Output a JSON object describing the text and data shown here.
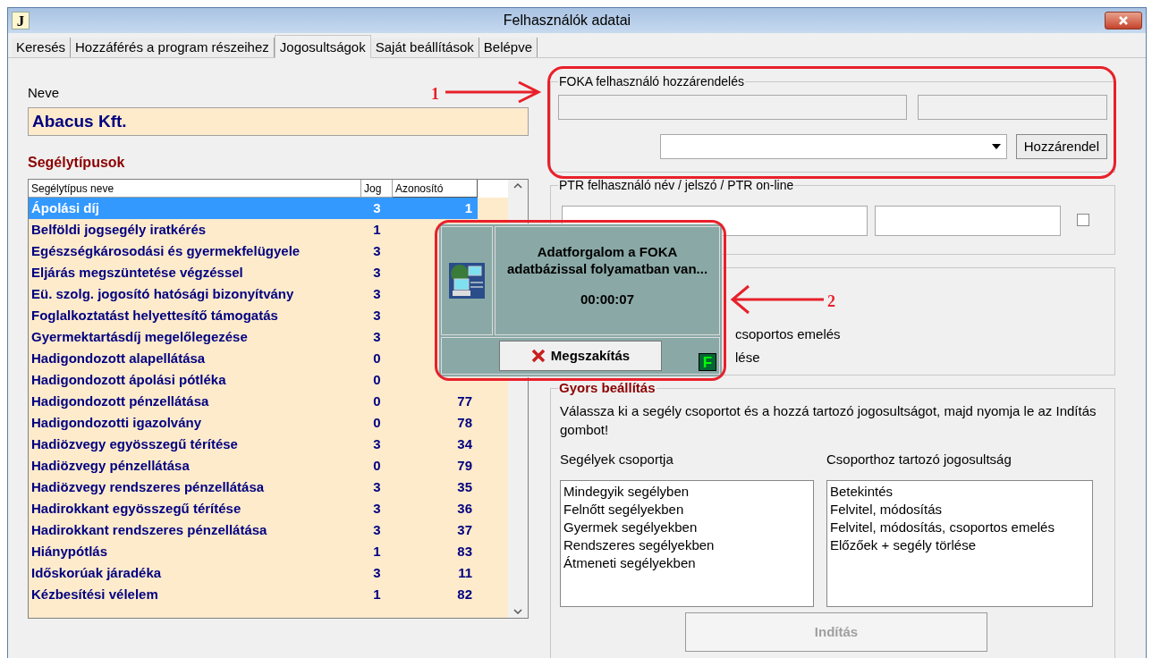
{
  "window": {
    "icon_letter": "J",
    "title": "Felhasználók adatai"
  },
  "tabs": [
    {
      "label": "Keresés",
      "selected": false
    },
    {
      "label": "Hozzáférés a program részeihez",
      "selected": false
    },
    {
      "label": "Jogosultságok",
      "selected": true
    },
    {
      "label": "Saját beállítások",
      "selected": false
    },
    {
      "label": "Belépve",
      "selected": false
    }
  ],
  "left": {
    "name_label": "Neve",
    "name_value": "Abacus Kft.",
    "list_title": "Segélytípusok",
    "table": {
      "columns": [
        "Segélytípus neve",
        "Jog",
        "Azonosító"
      ],
      "rows": [
        {
          "name": "Ápolási díj",
          "jog": "3",
          "id": "1",
          "selected": true
        },
        {
          "name": "Belföldi jogsegély iratkérés",
          "jog": "1",
          "selected": false
        },
        {
          "name": "Egészségkárosodási és gyermekfelügyele",
          "jog": "3",
          "selected": false
        },
        {
          "name": "Eljárás megszüntetése végzéssel",
          "jog": "3",
          "selected": false
        },
        {
          "name": "Eü. szolg. jogosító hatósági bizonyítvány",
          "jog": "3",
          "selected": false
        },
        {
          "name": "Foglalkoztatást helyettesítő támogatás",
          "jog": "3",
          "selected": false
        },
        {
          "name": "Gyermektartásdíj megelőlegezése",
          "jog": "3",
          "selected": false
        },
        {
          "name": "Hadigondozott alapellátása",
          "jog": "0",
          "selected": false
        },
        {
          "name": "Hadigondozott ápolási pótléka",
          "jog": "0",
          "selected": false
        },
        {
          "name": "Hadigondozott pénzellátása",
          "jog": "0",
          "id": "77",
          "selected": false
        },
        {
          "name": "Hadigondozotti igazolvány",
          "jog": "0",
          "id": "78",
          "selected": false
        },
        {
          "name": "Hadiözvegy egyösszegű térítése",
          "jog": "3",
          "id": "34",
          "selected": false
        },
        {
          "name": "Hadiözvegy pénzellátása",
          "jog": "0",
          "id": "79",
          "selected": false
        },
        {
          "name": "Hadiözvegy rendszeres pénzellátása",
          "jog": "3",
          "id": "35",
          "selected": false
        },
        {
          "name": "Hadirokkant egyösszegű térítése",
          "jog": "3",
          "id": "36",
          "selected": false
        },
        {
          "name": "Hadirokkant rendszeres pénzellátása",
          "jog": "3",
          "id": "37",
          "selected": false
        },
        {
          "name": "Hiánypótlás",
          "jog": "1",
          "id": "83",
          "selected": false
        },
        {
          "name": "Időskorúak járadéka",
          "jog": "3",
          "id": "11",
          "selected": false
        },
        {
          "name": "Kézbesítési vélelem",
          "jog": "1",
          "id": "82",
          "selected": false
        }
      ]
    }
  },
  "foka_group": {
    "legend": "FOKA felhasználó hozzárendelés",
    "button": "Hozzárendel"
  },
  "ptr_group": {
    "legend": "PTR felhasználó név / jelszó / PTR on-line",
    "checkbox": {
      "checked": false
    }
  },
  "rights_group": {
    "lines": [
      "csoportos emelés",
      "lése"
    ]
  },
  "quick_setup": {
    "legend": "Gyors beállítás",
    "instruction": "Válassza ki a segély csoportot és a  hozzá tartozó jogosultságot, majd nyomja le az Indítás gombot!",
    "groups_label": "Segélyek csoportja",
    "groups": [
      "Mindegyik segélyben",
      "Felnőtt segélyekben",
      "Gyermek segélyekben",
      "Rendszeres segélyekben",
      "Átmeneti segélyekben"
    ],
    "rights_label": "Csoporthoz tartozó jogosultság",
    "rights": [
      "Betekintés",
      "Felvitel, módosítás",
      "Felvitel, módosítás, csoportos emelés",
      "Előzőek + segély törlése"
    ],
    "start_button": {
      "label": "Indítás",
      "disabled": true
    }
  },
  "progress_dialog": {
    "message": "Adatforgalom a FOKA adatbázissal folyamatban van...",
    "elapsed": "00:00:07",
    "cancel_button": "Megszakítás",
    "badge": "F"
  },
  "annotations": [
    {
      "number": "1"
    },
    {
      "number": "2"
    }
  ]
}
